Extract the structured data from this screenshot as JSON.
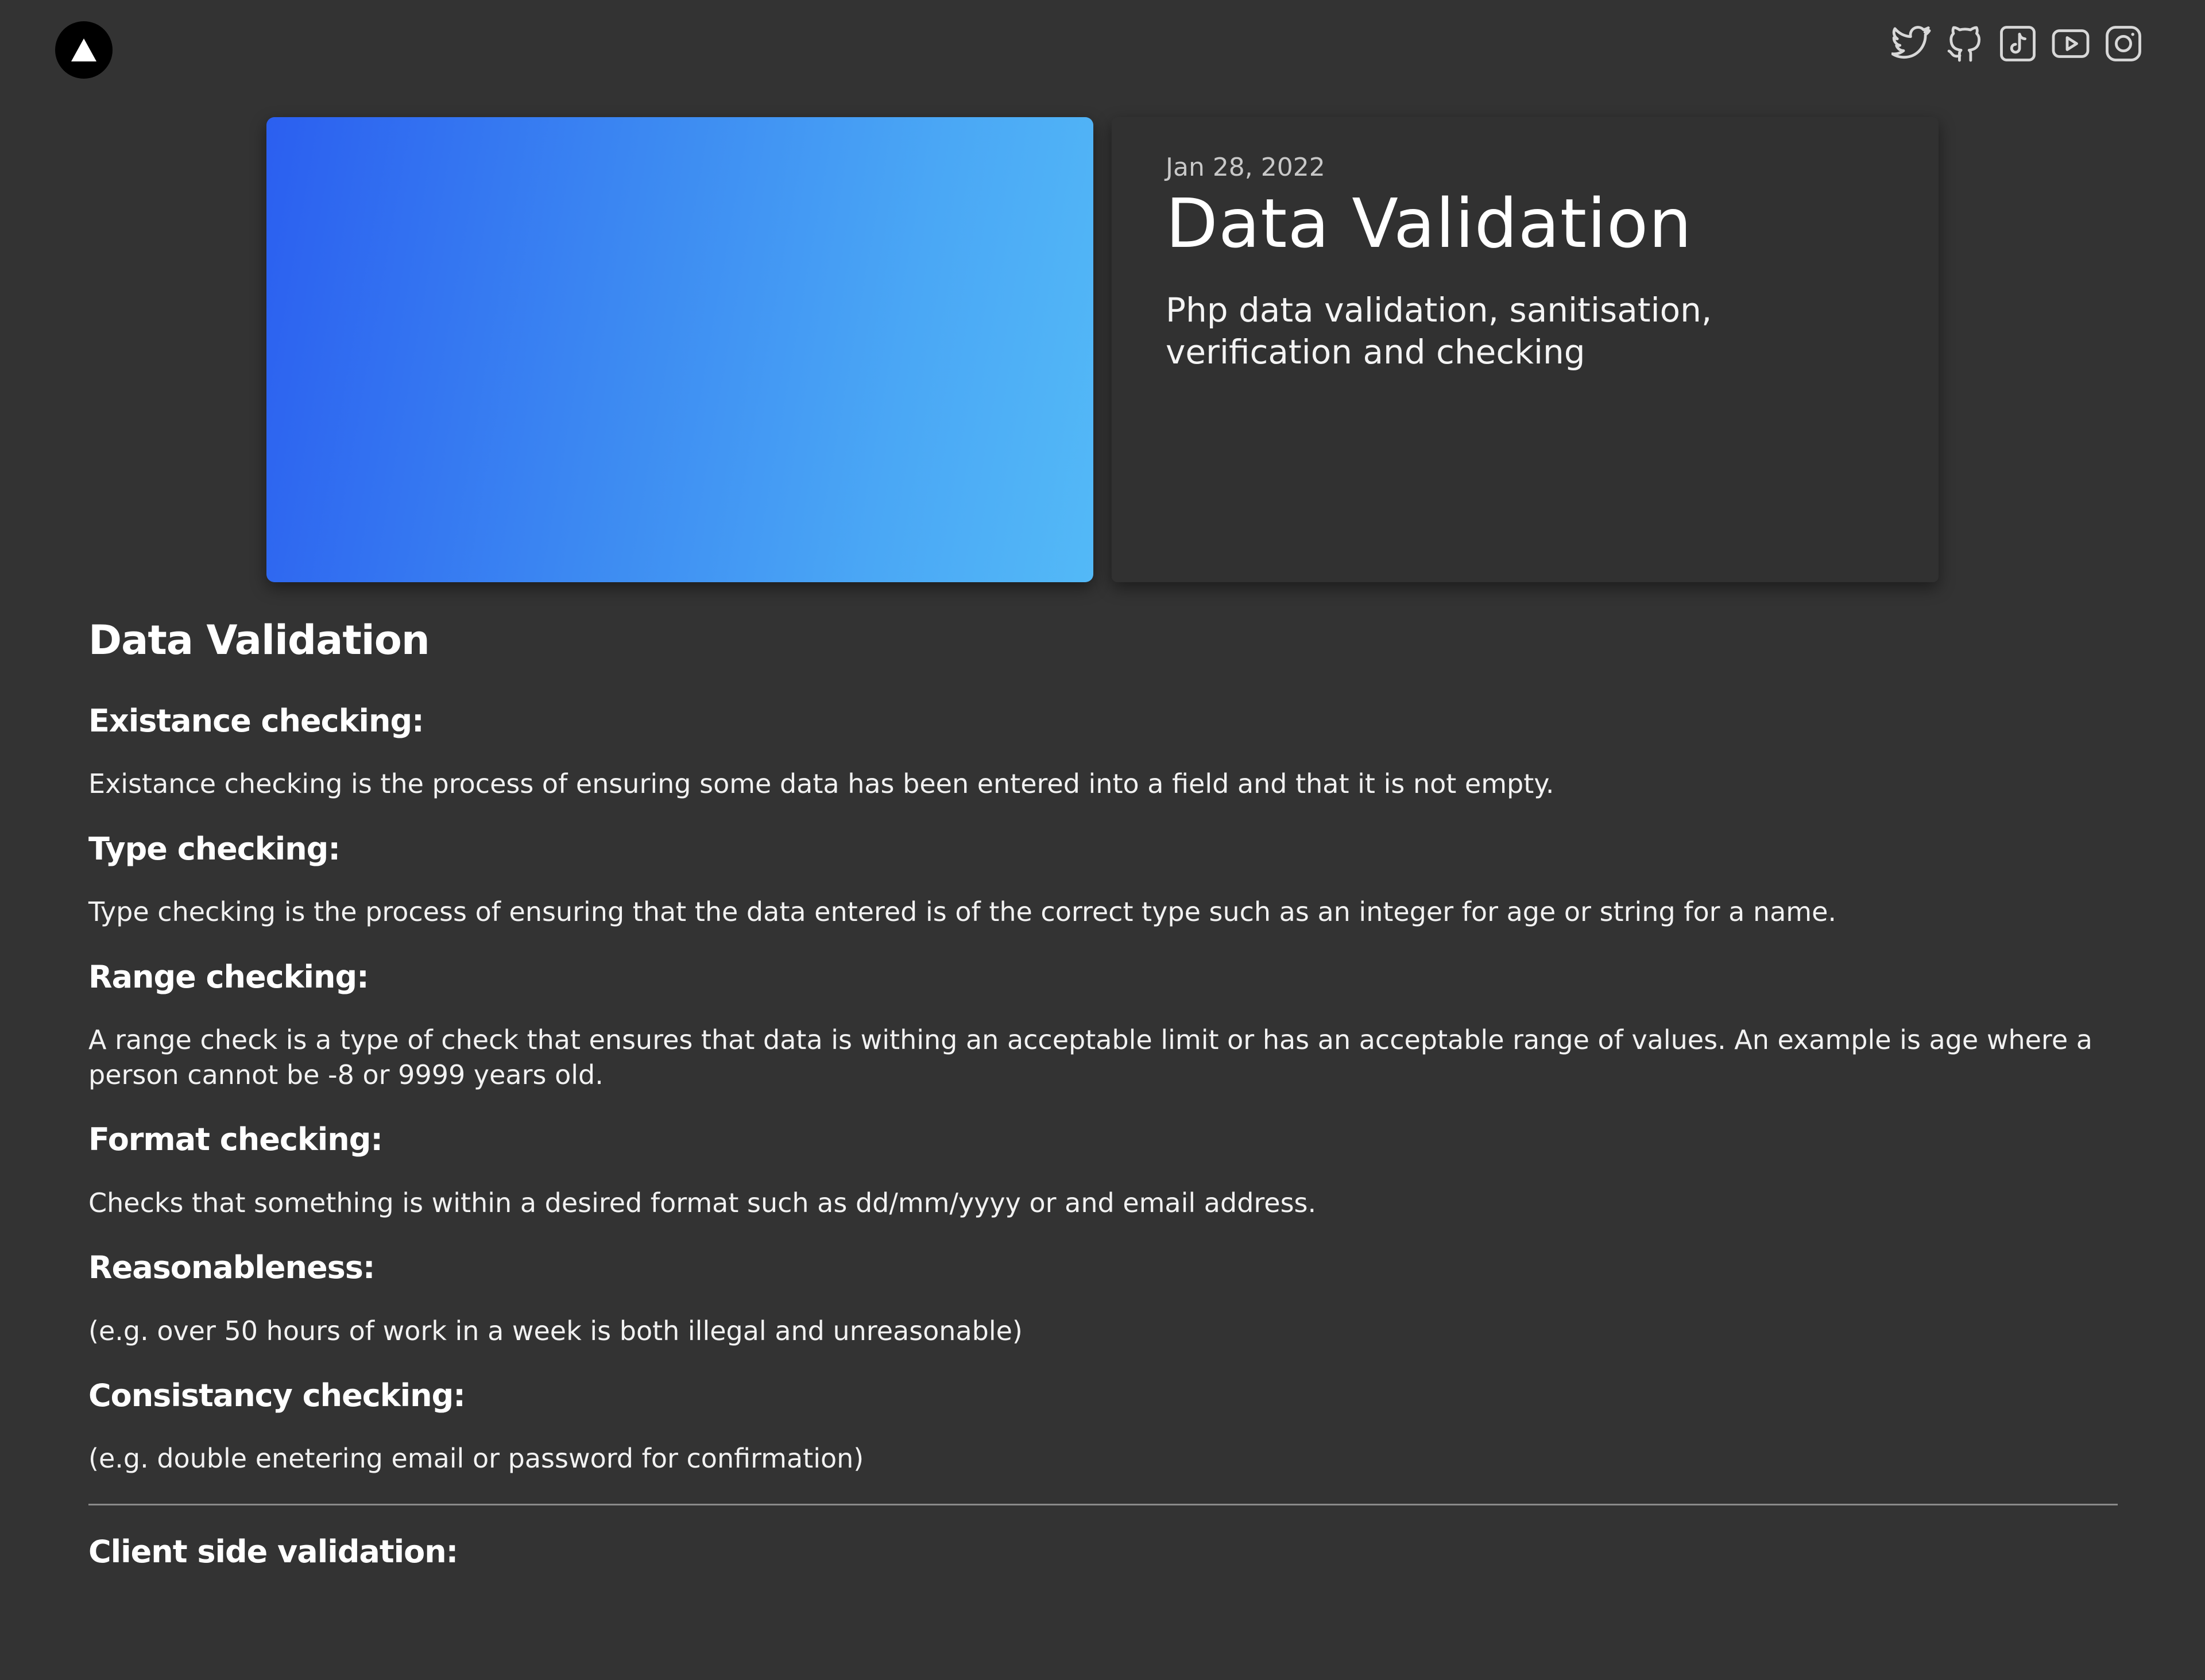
{
  "header": {
    "logo_icon": "triangle-logo-icon",
    "socials": [
      {
        "name": "twitter",
        "icon": "twitter-icon"
      },
      {
        "name": "github",
        "icon": "github-icon"
      },
      {
        "name": "tiktok",
        "icon": "tiktok-icon"
      },
      {
        "name": "youtube",
        "icon": "youtube-icon"
      },
      {
        "name": "instagram",
        "icon": "instagram-icon"
      }
    ]
  },
  "hero": {
    "date": "Jan 28, 2022",
    "title": "Data Validation",
    "subtitle": "Php data validation, sanitisation, verification and checking",
    "gradient_colors": [
      "#2b5ff0",
      "#53b9f7"
    ]
  },
  "article": {
    "heading": "Data Validation",
    "sections": [
      {
        "title": "Existance checking:",
        "body": "Existance checking is the process of ensuring some data has been entered into a field and that it is not empty."
      },
      {
        "title": "Type checking:",
        "body": "Type checking is the process of ensuring that the data entered is of the correct type such as an integer for age or string for a name."
      },
      {
        "title": "Range checking:",
        "body": "A range check is a type of check that ensures that data is withing an acceptable limit or has an acceptable range of values. An example is age where a person cannot be -8 or 9999 years old."
      },
      {
        "title": "Format checking:",
        "body": "Checks that something is within a desired format such as dd/mm/yyyy or and email address."
      },
      {
        "title": "Reasonableness:",
        "body": "(e.g. over 50 hours of work in a week is both illegal and unreasonable)"
      },
      {
        "title": "Consistancy checking:",
        "body": "(e.g. double enetering email or password for confirmation)"
      }
    ],
    "next_section_title": "Client side validation:"
  },
  "colors": {
    "background": "#333333",
    "card": "#313131",
    "text": "#ffffff",
    "muted": "#c8c8c8",
    "icon": "#d8d8d8"
  }
}
